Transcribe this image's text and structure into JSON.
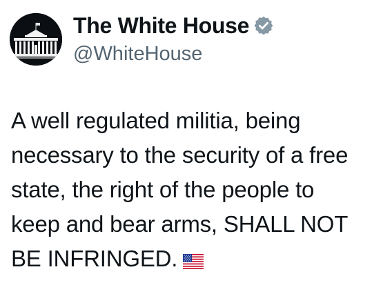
{
  "account": {
    "display_name": "The White House",
    "handle": "@WhiteHouse",
    "avatar_icon": "white-house-building-icon",
    "verified_icon": "verified-badge-icon",
    "verified_color": "#8899a6"
  },
  "tweet": {
    "lines": [
      "A well regulated militia, being",
      "necessary to the security of a free",
      "state, the right of the people to",
      "keep and bear arms, SHALL NOT",
      "BE INFRINGED."
    ],
    "emoji": "us-flag-icon"
  },
  "colors": {
    "text": "#0f1419",
    "handle": "#536471",
    "background": "#ffffff"
  }
}
